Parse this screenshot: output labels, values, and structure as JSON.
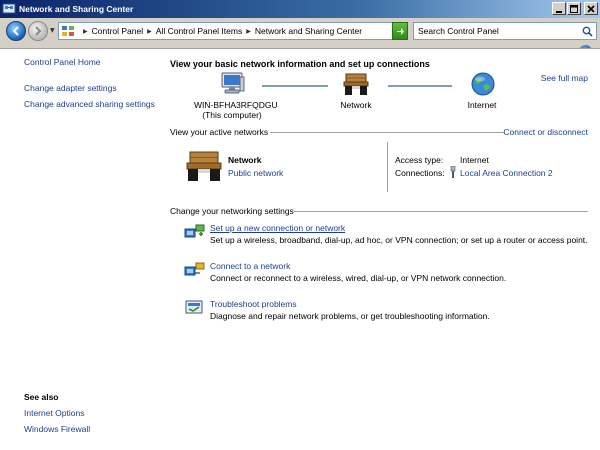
{
  "window": {
    "title": "Network and Sharing Center"
  },
  "address_bar": {
    "crumbs": [
      "Control Panel",
      "All Control Panel Items",
      "Network and Sharing Center"
    ],
    "search_placeholder": "Search Control Panel"
  },
  "sidebar": {
    "home": "Control Panel Home",
    "links": [
      "Change adapter settings",
      "Change advanced sharing settings"
    ],
    "see_also_title": "See also",
    "see_also_links": [
      "Internet Options",
      "Windows Firewall"
    ]
  },
  "main": {
    "heading": "View your basic network information and set up connections",
    "see_full_map": "See full map",
    "map": {
      "computer_name": "WIN-BFHA3RFQDGU",
      "computer_caption": "(This computer)",
      "network_label": "Network",
      "internet_label": "Internet"
    },
    "active_networks": {
      "title": "View your active networks",
      "connect_link": "Connect or disconnect",
      "network_name": "Network",
      "network_type": "Public network",
      "access_type_label": "Access type:",
      "access_type_value": "Internet",
      "connections_label": "Connections:",
      "connections_value": "Local Area Connection 2"
    },
    "settings": {
      "title": "Change your networking settings",
      "tasks": [
        {
          "title": "Set up a new connection or network",
          "desc": "Set up a wireless, broadband, dial-up, ad hoc, or VPN connection; or set up a router or access point."
        },
        {
          "title": "Connect to a network",
          "desc": "Connect or reconnect to a wireless, wired, dial-up, or VPN network connection."
        },
        {
          "title": "Troubleshoot problems",
          "desc": "Diagnose and repair network problems, or get troubleshooting information."
        }
      ]
    }
  },
  "colors": {
    "link": "#1e3f8f",
    "titlebar_start": "#0a246a",
    "titlebar_end": "#a6caf0",
    "divider": "#a0a0a0"
  }
}
